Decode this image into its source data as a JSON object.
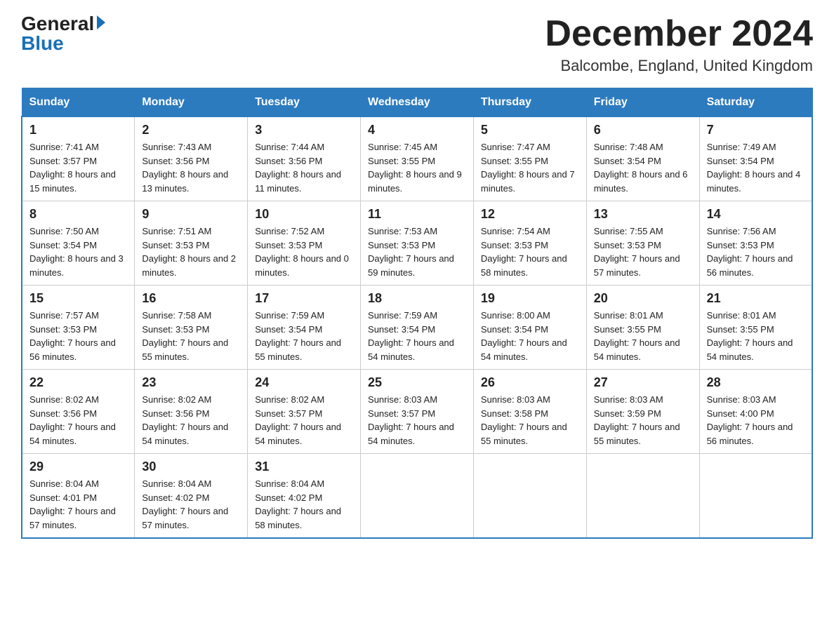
{
  "header": {
    "logo_general": "General",
    "logo_blue": "Blue",
    "month_title": "December 2024",
    "location": "Balcombe, England, United Kingdom"
  },
  "days_of_week": [
    "Sunday",
    "Monday",
    "Tuesday",
    "Wednesday",
    "Thursday",
    "Friday",
    "Saturday"
  ],
  "weeks": [
    [
      {
        "day": "1",
        "sunrise": "7:41 AM",
        "sunset": "3:57 PM",
        "daylight": "8 hours and 15 minutes."
      },
      {
        "day": "2",
        "sunrise": "7:43 AM",
        "sunset": "3:56 PM",
        "daylight": "8 hours and 13 minutes."
      },
      {
        "day": "3",
        "sunrise": "7:44 AM",
        "sunset": "3:56 PM",
        "daylight": "8 hours and 11 minutes."
      },
      {
        "day": "4",
        "sunrise": "7:45 AM",
        "sunset": "3:55 PM",
        "daylight": "8 hours and 9 minutes."
      },
      {
        "day": "5",
        "sunrise": "7:47 AM",
        "sunset": "3:55 PM",
        "daylight": "8 hours and 7 minutes."
      },
      {
        "day": "6",
        "sunrise": "7:48 AM",
        "sunset": "3:54 PM",
        "daylight": "8 hours and 6 minutes."
      },
      {
        "day": "7",
        "sunrise": "7:49 AM",
        "sunset": "3:54 PM",
        "daylight": "8 hours and 4 minutes."
      }
    ],
    [
      {
        "day": "8",
        "sunrise": "7:50 AM",
        "sunset": "3:54 PM",
        "daylight": "8 hours and 3 minutes."
      },
      {
        "day": "9",
        "sunrise": "7:51 AM",
        "sunset": "3:53 PM",
        "daylight": "8 hours and 2 minutes."
      },
      {
        "day": "10",
        "sunrise": "7:52 AM",
        "sunset": "3:53 PM",
        "daylight": "8 hours and 0 minutes."
      },
      {
        "day": "11",
        "sunrise": "7:53 AM",
        "sunset": "3:53 PM",
        "daylight": "7 hours and 59 minutes."
      },
      {
        "day": "12",
        "sunrise": "7:54 AM",
        "sunset": "3:53 PM",
        "daylight": "7 hours and 58 minutes."
      },
      {
        "day": "13",
        "sunrise": "7:55 AM",
        "sunset": "3:53 PM",
        "daylight": "7 hours and 57 minutes."
      },
      {
        "day": "14",
        "sunrise": "7:56 AM",
        "sunset": "3:53 PM",
        "daylight": "7 hours and 56 minutes."
      }
    ],
    [
      {
        "day": "15",
        "sunrise": "7:57 AM",
        "sunset": "3:53 PM",
        "daylight": "7 hours and 56 minutes."
      },
      {
        "day": "16",
        "sunrise": "7:58 AM",
        "sunset": "3:53 PM",
        "daylight": "7 hours and 55 minutes."
      },
      {
        "day": "17",
        "sunrise": "7:59 AM",
        "sunset": "3:54 PM",
        "daylight": "7 hours and 55 minutes."
      },
      {
        "day": "18",
        "sunrise": "7:59 AM",
        "sunset": "3:54 PM",
        "daylight": "7 hours and 54 minutes."
      },
      {
        "day": "19",
        "sunrise": "8:00 AM",
        "sunset": "3:54 PM",
        "daylight": "7 hours and 54 minutes."
      },
      {
        "day": "20",
        "sunrise": "8:01 AM",
        "sunset": "3:55 PM",
        "daylight": "7 hours and 54 minutes."
      },
      {
        "day": "21",
        "sunrise": "8:01 AM",
        "sunset": "3:55 PM",
        "daylight": "7 hours and 54 minutes."
      }
    ],
    [
      {
        "day": "22",
        "sunrise": "8:02 AM",
        "sunset": "3:56 PM",
        "daylight": "7 hours and 54 minutes."
      },
      {
        "day": "23",
        "sunrise": "8:02 AM",
        "sunset": "3:56 PM",
        "daylight": "7 hours and 54 minutes."
      },
      {
        "day": "24",
        "sunrise": "8:02 AM",
        "sunset": "3:57 PM",
        "daylight": "7 hours and 54 minutes."
      },
      {
        "day": "25",
        "sunrise": "8:03 AM",
        "sunset": "3:57 PM",
        "daylight": "7 hours and 54 minutes."
      },
      {
        "day": "26",
        "sunrise": "8:03 AM",
        "sunset": "3:58 PM",
        "daylight": "7 hours and 55 minutes."
      },
      {
        "day": "27",
        "sunrise": "8:03 AM",
        "sunset": "3:59 PM",
        "daylight": "7 hours and 55 minutes."
      },
      {
        "day": "28",
        "sunrise": "8:03 AM",
        "sunset": "4:00 PM",
        "daylight": "7 hours and 56 minutes."
      }
    ],
    [
      {
        "day": "29",
        "sunrise": "8:04 AM",
        "sunset": "4:01 PM",
        "daylight": "7 hours and 57 minutes."
      },
      {
        "day": "30",
        "sunrise": "8:04 AM",
        "sunset": "4:02 PM",
        "daylight": "7 hours and 57 minutes."
      },
      {
        "day": "31",
        "sunrise": "8:04 AM",
        "sunset": "4:02 PM",
        "daylight": "7 hours and 58 minutes."
      },
      null,
      null,
      null,
      null
    ]
  ]
}
